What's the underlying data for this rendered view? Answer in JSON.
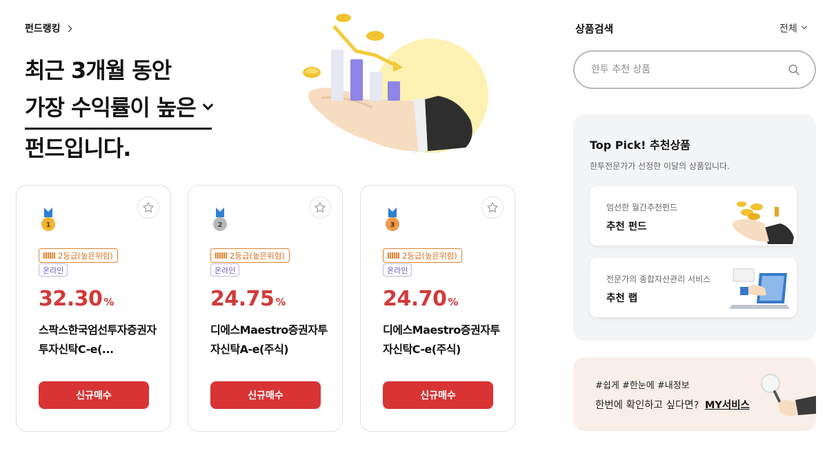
{
  "ranking": {
    "link_label": "펀드랭킹",
    "headline_line1": "최근 3개월 동안",
    "headline_selector": "가장 수익률이 높은",
    "headline_line3": "펀드입니다."
  },
  "cards": [
    {
      "rank": "1",
      "medal_color": "#f1b52f",
      "grade": "2등급(높은위험)",
      "channel": "온라인",
      "rate": "32.30",
      "rate_unit": "%",
      "name": "스팍스한국엄선투자증권자투자신탁C-e(...",
      "buy_label": "신규매수"
    },
    {
      "rank": "2",
      "medal_color": "#b8b8b8",
      "grade": "2등급(높은위험)",
      "channel": "온라인",
      "rate": "24.75",
      "rate_unit": "%",
      "name": "디에스Maestro증권자투자신탁A-e(주식)",
      "buy_label": "신규매수"
    },
    {
      "rank": "3",
      "medal_color": "#ec9a4e",
      "grade": "2등급(높은위험)",
      "channel": "온라인",
      "rate": "24.70",
      "rate_unit": "%",
      "name": "디에스Maestro증권자투자신탁C-e(주식)",
      "buy_label": "신규매수"
    }
  ],
  "search": {
    "title": "상품검색",
    "filter_label": "전체",
    "placeholder": "한투 추천 상품",
    "icon": "search-icon"
  },
  "top_pick": {
    "title": "Top Pick! 추천상품",
    "description": "한투전문가가 선정한 이달의 상품입니다.",
    "items": [
      {
        "sub": "엄선한 월간추천펀드",
        "main_prefix": "추천 ",
        "main_bold": "펀드",
        "icon": "coins-hand-illustration"
      },
      {
        "sub": "전문가의 종합자산관리 서비스",
        "main_prefix": "추천 ",
        "main_bold": "랩",
        "icon": "laptop-hand-illustration"
      }
    ]
  },
  "my_service": {
    "tags": "#쉽게  #한눈에  #내정보",
    "text": "한번에 확인하고 싶다면?",
    "link": "MY서비스",
    "icon": "magnifier-hand-illustration"
  },
  "colors": {
    "accent_red": "#d83434",
    "rate_red": "#d33a3a",
    "grade_orange": "#e0812a",
    "online_purple": "#6a52c4",
    "panel_gray": "#f3f4f6",
    "my_peach": "#f9efe8"
  }
}
